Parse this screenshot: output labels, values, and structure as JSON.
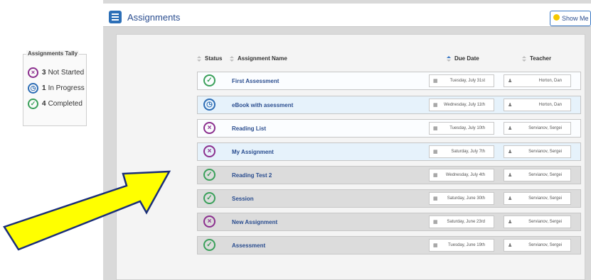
{
  "app": {
    "title": "Assignments",
    "show_me_how": "Show Me How"
  },
  "tally": {
    "title": "Assignments Tally",
    "items": [
      {
        "count": "3",
        "label": "Not Started",
        "status": "not-started"
      },
      {
        "count": "1",
        "label": "In Progress",
        "status": "in-progress"
      },
      {
        "count": "4",
        "label": "Completed",
        "status": "completed"
      }
    ]
  },
  "columns": {
    "status": "Status",
    "name": "Assignment Name",
    "due": "Due Date",
    "teacher": "Teacher"
  },
  "rows": [
    {
      "name": "First Assessment",
      "due": "Tuesday, July 31st",
      "teacher": "Horton, Dan",
      "status": "completed"
    },
    {
      "name": "eBook with asessment",
      "due": "Wednesday, July 11th",
      "teacher": "Horton, Dan",
      "status": "in-progress"
    },
    {
      "name": "Reading List",
      "due": "Tuesday, July 10th",
      "teacher": "Servianov, Sergei",
      "status": "not-started"
    },
    {
      "name": "My Assignment",
      "due": "Saturday, July 7th",
      "teacher": "Servianov, Sergei",
      "status": "not-started"
    },
    {
      "name": "Reading Test 2",
      "due": "Wednesday, July 4th",
      "teacher": "Servianov, Sergei",
      "status": "completed"
    },
    {
      "name": "Session",
      "due": "Saturday, June 30th",
      "teacher": "Servianov, Sergei",
      "status": "completed"
    },
    {
      "name": "New Assignment",
      "due": "Saturday, June 23rd",
      "teacher": "Servianov, Sergei",
      "status": "not-started"
    },
    {
      "name": "Assessment",
      "due": "Tuesday, June 19th",
      "teacher": "Servianov, Sergei",
      "status": "completed"
    }
  ],
  "colors": {
    "completed": "#3aa05a",
    "in_progress": "#2d6db5",
    "not_started": "#8b2f8e",
    "arrow": "#ffff00",
    "link": "#2a4d8f"
  },
  "icons": {
    "completed": "check-circle-icon",
    "in_progress": "clock-icon",
    "not_started": "x-circle-icon",
    "due": "calendar-icon",
    "teacher": "person-icon"
  }
}
